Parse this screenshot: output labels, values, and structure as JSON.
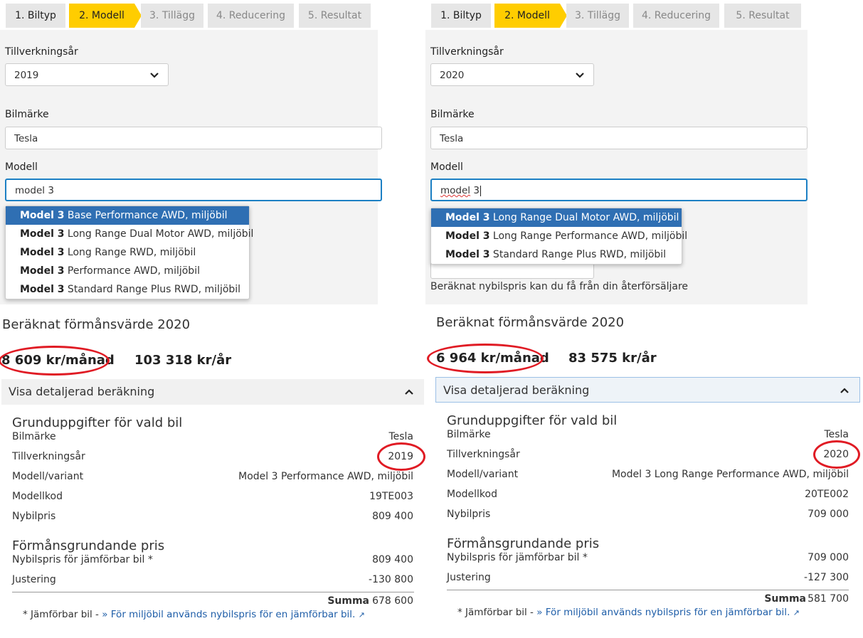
{
  "steps": [
    "1. Biltyp",
    "2. Modell",
    "3. Tillägg",
    "4. Reducering",
    "5. Resultat"
  ],
  "form": {
    "year_label": "Tillverkningsår",
    "brand_label": "Bilmärke",
    "model_label": "Modell"
  },
  "left": {
    "year_value": "2019",
    "brand_value": "Tesla",
    "model_value": "model 3",
    "dropdown": [
      {
        "bold": "Model 3",
        "rest": " Base Performance AWD, miljöbil"
      },
      {
        "bold": "Model 3",
        "rest": " Long Range Dual Motor AWD, miljöbil"
      },
      {
        "bold": "Model 3",
        "rest": " Long Range RWD, miljöbil"
      },
      {
        "bold": "Model 3",
        "rest": " Performance AWD, miljöbil"
      },
      {
        "bold": "Model 3",
        "rest": " Standard Range Plus RWD, miljöbil"
      }
    ],
    "result_title": "Beräknat förmånsvärde 2020",
    "per_month": "8 609 kr/månad",
    "per_year": "103 318 kr/år",
    "accordion_label": "Visa detaljerad beräkning",
    "basic_title": "Grunduppgifter för vald bil",
    "rows": [
      {
        "label": "Bilmärke",
        "value": "Tesla"
      },
      {
        "label": "Tillverkningsår",
        "value": "2019"
      },
      {
        "label": "Modell/variant",
        "value": "Model 3 Performance AWD, miljöbil"
      },
      {
        "label": "Modellkod",
        "value": "19TE003"
      },
      {
        "label": "Nybilpris",
        "value": "809 400"
      }
    ],
    "price_title": "Förmånsgrundande pris",
    "price_rows": [
      {
        "label": "Nybilspris för jämförbar bil *",
        "value": "809 400"
      },
      {
        "label": "Justering",
        "value": "-130 800"
      }
    ],
    "sum_label": "Summa",
    "sum_value": "678 600",
    "foot_prefix": "* Jämförbar bil - ",
    "foot_link": "» För miljöbil används nybilspris för en jämförbar bil."
  },
  "right": {
    "year_value": "2020",
    "brand_value": "Tesla",
    "model_value_a": "model",
    "model_value_b": " 3",
    "dropdown": [
      {
        "bold": "Model 3",
        "rest": " Long Range Dual Motor AWD, miljöbil"
      },
      {
        "bold": "Model 3",
        "rest": " Long Range Performance AWD, miljöbil"
      },
      {
        "bold": "Model 3",
        "rest": " Standard Range Plus RWD, miljöbil"
      }
    ],
    "hint": "Beräknat nybilspris kan du få från din återförsäljare",
    "result_title": "Beräknat förmånsvärde 2020",
    "per_month": "6 964 kr/månad",
    "per_year": "83 575 kr/år",
    "accordion_label": "Visa detaljerad beräkning",
    "basic_title": "Grunduppgifter för vald bil",
    "rows": [
      {
        "label": "Bilmärke",
        "value": "Tesla"
      },
      {
        "label": "Tillverkningsår",
        "value": "2020"
      },
      {
        "label": "Modell/variant",
        "value": "Model 3 Long Range Performance AWD, miljöbil"
      },
      {
        "label": "Modellkod",
        "value": "20TE002"
      },
      {
        "label": "Nybilpris",
        "value": "709 000"
      }
    ],
    "price_title": "Förmånsgrundande pris",
    "price_rows": [
      {
        "label": "Nybilspris för jämförbar bil *",
        "value": "709 000"
      },
      {
        "label": "Justering",
        "value": "-127 300"
      }
    ],
    "sum_label": "Summa",
    "sum_value": "581 700",
    "foot_prefix": "* Jämförbar bil - ",
    "foot_link": "» För miljöbil används nybilspris för en jämförbar bil."
  },
  "colors": {
    "active_step": "#ffcd00",
    "selected_option": "#2f6fb3",
    "annotation_ring": "#e01b24",
    "link": "#1f5ea8"
  },
  "icons": {
    "select_chevron": "chevron-down-icon",
    "accordion_chevron": "chevron-up-icon",
    "external_link": "external-link-icon"
  }
}
